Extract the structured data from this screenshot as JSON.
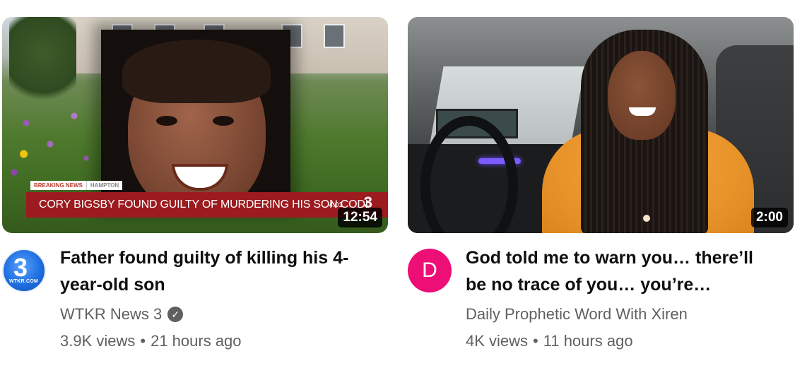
{
  "videos": [
    {
      "title": "Father found guilty of killing his 4-year-old son",
      "channel": "WTKR News 3",
      "verified": true,
      "views": "3.9K views",
      "age": "21 hours ago",
      "duration": "12:54",
      "avatar": {
        "primary": "3",
        "secondary": "WTKR.COM"
      },
      "thumbnail": {
        "breaking_label": "BREAKING NEWS",
        "location_label": "HAMPTON",
        "headline": "CORY BIGSBY FOUND GUILTY OF MURDERING HIS SON CODI",
        "clock": "4:01",
        "station_logo": "3"
      }
    },
    {
      "title": "God told me to warn you… there’ll be no trace of you… you’re…",
      "channel": "Daily Prophetic Word With Xiren",
      "verified": false,
      "views": "4K views",
      "age": "11 hours ago",
      "duration": "2:00",
      "avatar": {
        "primary": "D"
      }
    }
  ],
  "colors": {
    "avatar_d": "#ee0f76",
    "secondary_text": "#606060",
    "lower_third": "#9b1b1f"
  },
  "icons": {
    "verified": "check-circle-icon"
  },
  "separator": "•"
}
